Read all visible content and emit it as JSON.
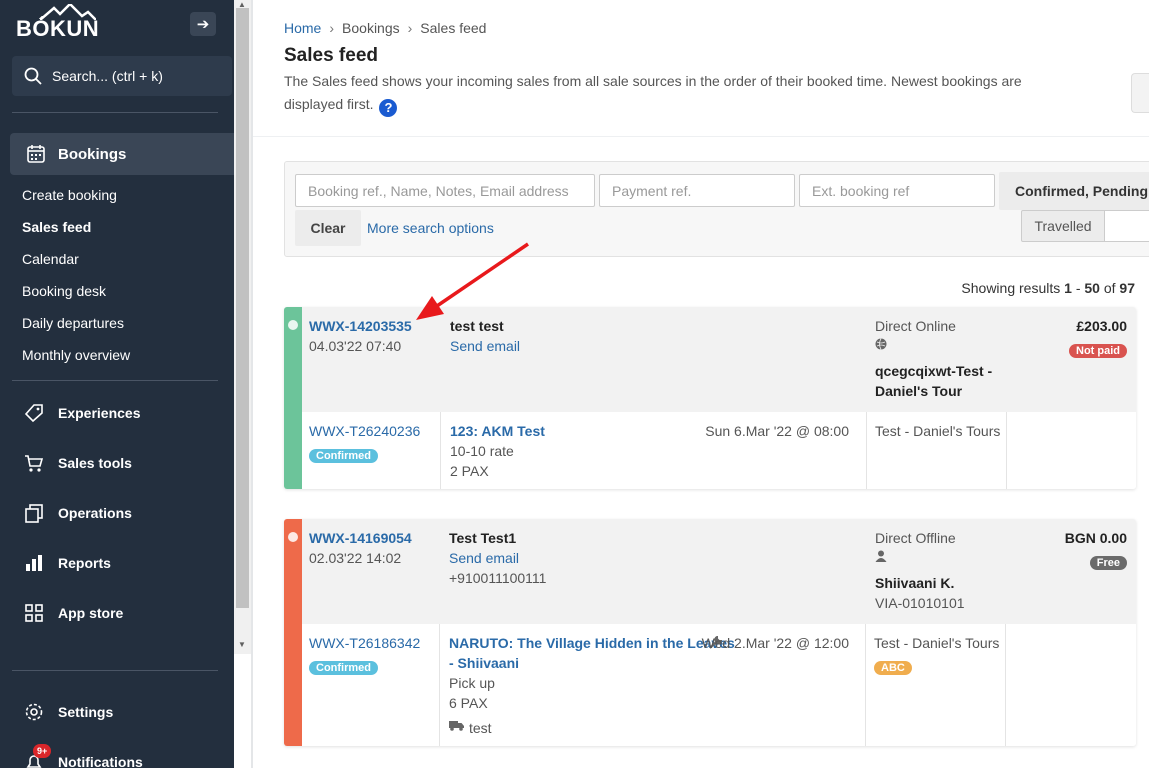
{
  "brand": {
    "name": "BÓKUN",
    "accent": "#232f3e"
  },
  "search": {
    "label": "Search... (ctrl + k)"
  },
  "nav": {
    "active": "Bookings",
    "sub_items": [
      "Create booking",
      "Sales feed",
      "Calendar",
      "Booking desk",
      "Daily departures",
      "Monthly overview"
    ],
    "items": [
      "Experiences",
      "Sales tools",
      "Operations",
      "Reports",
      "App store"
    ],
    "settings": "Settings",
    "notifications": "Notifications",
    "notifications_badge": "9+"
  },
  "breadcrumb": {
    "home": "Home",
    "bookings": "Bookings",
    "current": "Sales feed"
  },
  "page": {
    "title": "Sales feed",
    "description": "The Sales feed shows your incoming sales from all sale sources in the order of their booked time. Newest bookings are displayed first."
  },
  "filters": {
    "booking_ref_placeholder": "Booking ref., Name, Notes, Email address",
    "payment_ref_placeholder": "Payment ref.",
    "ext_ref_placeholder": "Ext. booking ref",
    "status": "Confirmed, Pending",
    "clear": "Clear",
    "more": "More search options",
    "travelled": "Travelled"
  },
  "results": {
    "prefix": "Showing results",
    "from": "1",
    "dash": "-",
    "to": "50",
    "of": "of",
    "total": "97"
  },
  "bookings": [
    {
      "ref": "WWX-14203535",
      "date": "04.03'22 07:40",
      "customer": "test test",
      "send_email": "Send email",
      "phone": "",
      "channel": "Direct Online",
      "seller": "qcegcqixwt-Test - Daniel's Tour",
      "seller_line1": "qcegcqixwt-Test -",
      "seller_line2": "Daniel's Tour",
      "price": "£203.00",
      "payment_status": "Not paid",
      "payment_color": "#d9534f",
      "stripe_color": "#6cc49a",
      "item": {
        "ref": "WWX-T26240236",
        "status": "Confirmed",
        "product": "123: AKM Test",
        "product_line2": "",
        "date": "Sun 6.Mar '22 @ 08:00",
        "rate": "10-10 rate",
        "pax": "2 PAX",
        "supplier": "Test - Daniel's Tours"
      }
    },
    {
      "ref": "WWX-14169054",
      "date": "02.03'22 14:02",
      "customer": "Test Test1",
      "send_email": "Send email",
      "phone": "+910011100111",
      "channel": "Direct Offline",
      "seller_line1": "Shiivaani K.",
      "seller_line2": "VIA-01010101",
      "price": "BGN 0.00",
      "payment_status": "Free",
      "payment_color": "#6b6b6b",
      "stripe_color": "#ee6a4a",
      "item": {
        "ref": "WWX-T26186342",
        "status": "Confirmed",
        "product": "NARUTO: The Village Hidden in the Leaves",
        "product_line2": "- Shiivaani",
        "date": "Wed 2.Mar '22 @ 12:00",
        "rate": "Pick up",
        "pax": "6 PAX",
        "supplier": "Test - Daniel's Tours",
        "tag": "ABC",
        "transport": "test"
      }
    }
  ]
}
